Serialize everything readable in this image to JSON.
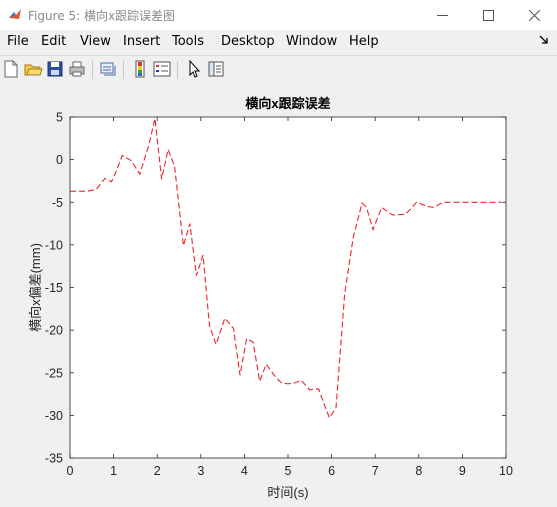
{
  "window": {
    "title": "Figure 5: 横向x跟踪误差图",
    "colors": {
      "titlebar_bg": "#ffffff",
      "title_text": "#8a8a8a",
      "figure_bg": "#f0f0f0"
    }
  },
  "menu": {
    "items": [
      "File",
      "Edit",
      "View",
      "Insert",
      "Tools",
      "Desktop",
      "Window",
      "Help"
    ]
  },
  "toolbar": {
    "buttons": [
      "new-figure-icon",
      "open-file-icon",
      "save-icon",
      "print-icon",
      "link-plot-icon",
      "insert-colorbar-icon",
      "insert-legend-icon",
      "edit-plot-arrow-icon",
      "property-inspector-icon"
    ]
  },
  "chart_data": {
    "type": "line",
    "title": "横向x跟踪误差",
    "xlabel": "时间(s)",
    "ylabel": "横向x偏差(mm)",
    "xlim": [
      0,
      10
    ],
    "ylim": [
      -35,
      5
    ],
    "xticks": [
      0,
      1,
      2,
      3,
      4,
      5,
      6,
      7,
      8,
      9,
      10
    ],
    "yticks": [
      5,
      0,
      -5,
      -10,
      -15,
      -20,
      -25,
      -30,
      -35
    ],
    "grid": false,
    "series": [
      {
        "color": "#e8262c",
        "style": "dashed",
        "x": [
          0,
          0.4,
          0.6,
          0.8,
          0.95,
          1.05,
          1.2,
          1.4,
          1.6,
          1.8,
          1.95,
          2.1,
          2.25,
          2.4,
          2.6,
          2.75,
          2.9,
          3.05,
          3.2,
          3.35,
          3.55,
          3.75,
          3.9,
          4.05,
          4.2,
          4.35,
          4.5,
          4.7,
          4.85,
          5.0,
          5.15,
          5.3,
          5.5,
          5.7,
          5.95,
          6.1,
          6.3,
          6.5,
          6.7,
          6.8,
          6.95,
          7.15,
          7.4,
          7.7,
          7.95,
          8.2,
          8.35,
          8.55,
          8.75,
          9.0,
          9.2,
          9.45,
          9.7,
          9.9
        ],
        "y": [
          -3.7,
          -3.7,
          -3.5,
          -2.2,
          -2.6,
          -1.5,
          0.5,
          -0.1,
          -1.7,
          1.6,
          4.8,
          -2.3,
          1.2,
          -0.8,
          -10.1,
          -7.5,
          -13.6,
          -11.2,
          -19.5,
          -21.7,
          -18.6,
          -19.8,
          -25.3,
          -21.0,
          -21.4,
          -26.0,
          -24.0,
          -25.4,
          -26.2,
          -26.3,
          -26.2,
          -25.9,
          -27.0,
          -26.9,
          -30.3,
          -29.1,
          -15.7,
          -9.0,
          -5.1,
          -5.6,
          -8.2,
          -5.6,
          -6.5,
          -6.4,
          -5.0,
          -5.5,
          -5.6,
          -5.0,
          -5.0,
          -5.0,
          -5.0,
          -5.0,
          -5.0,
          -5.0
        ]
      }
    ]
  }
}
